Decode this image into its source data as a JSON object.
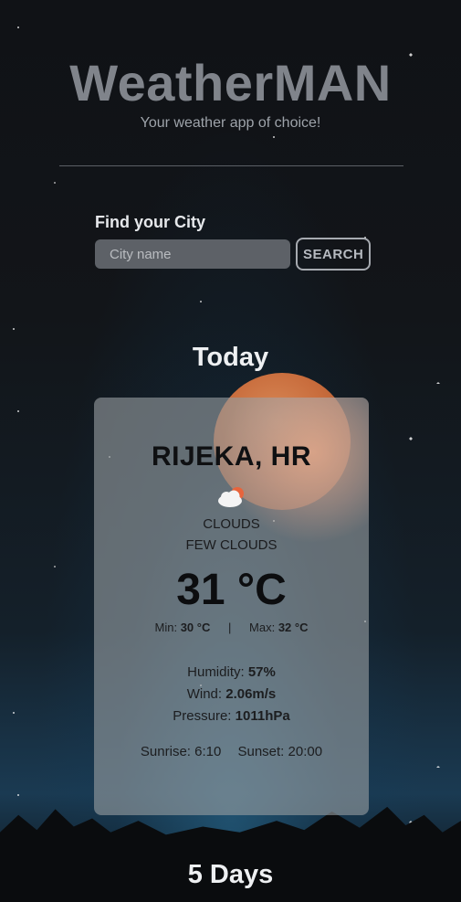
{
  "header": {
    "title": "WeatherMAN",
    "subtitle": "Your weather app of choice!"
  },
  "search": {
    "label": "Find your City",
    "placeholder": "City name",
    "value": "",
    "button_label": "SEARCH"
  },
  "today": {
    "section_title": "Today",
    "city": "RIJEKA, HR",
    "icon": "few-clouds-icon",
    "main": "CLOUDS",
    "description": "FEW CLOUDS",
    "temperature": "31 °C",
    "min_label": "Min:",
    "min_value": "30 °C",
    "separator": "|",
    "max_label": "Max:",
    "max_value": "32 °C",
    "humidity_label": "Humidity:",
    "humidity_value": "57%",
    "wind_label": "Wind:",
    "wind_value": "2.06m/s",
    "pressure_label": "Pressure:",
    "pressure_value": "1011hPa",
    "sunrise": "Sunrise: 6:10",
    "sunset": "Sunset: 20:00"
  },
  "forecast": {
    "section_title": "5 Days"
  },
  "colors": {
    "title": "#80848b",
    "card_bg": "#969ca0",
    "accent_sun": "#e8643c"
  }
}
